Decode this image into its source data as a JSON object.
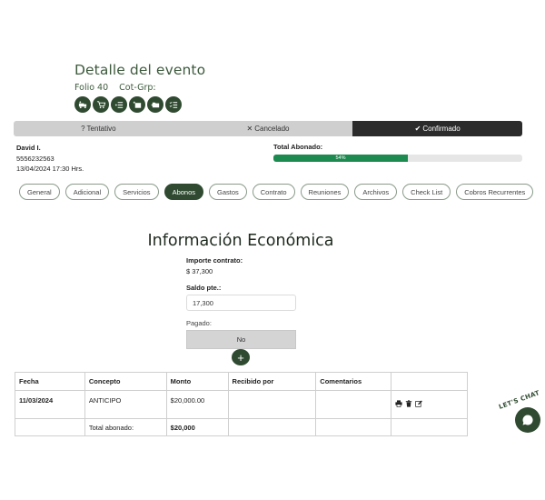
{
  "header": {
    "title": "Detalle del evento",
    "folio": "Folio 40",
    "cot_grp": "Cot-Grp:",
    "action_icons": [
      "truck-add-icon",
      "cart-add-icon",
      "list-add-icon",
      "package-add-icon",
      "folder-add-icon",
      "list-check-icon"
    ]
  },
  "status": {
    "tentativo": "Tentativo",
    "cancelado": "Cancelado",
    "confirmado": "Confirmado",
    "active": "confirmado",
    "active_color": "#2b2b2b"
  },
  "client": {
    "name": "David I.",
    "phone": "5556232563",
    "datetime": "13/04/2024 17:30 Hrs."
  },
  "abono": {
    "label": "Total Abonado:",
    "percent_text": "54%",
    "percent": 54,
    "color": "#1d8a4f"
  },
  "tabs": [
    "General",
    "Adicional",
    "Servicios",
    "Abonos",
    "Gastos",
    "Contrato",
    "Reuniones",
    "Archivos",
    "Check List",
    "Cobros Recurrentes"
  ],
  "active_tab": "Abonos",
  "economica": {
    "title": "Información Económica",
    "importe_label": "Importe contrato:",
    "importe_value": "$ 37,300",
    "saldo_label": "Saldo pte.:",
    "saldo_value": "17,300",
    "pagado_label": "Pagado:",
    "pagado_value": "No",
    "add_label": "+"
  },
  "table": {
    "headers": [
      "Fecha",
      "Concepto",
      "Monto",
      "Recibido por",
      "Comentarios",
      ""
    ],
    "rows": [
      {
        "fecha": "11/03/2024",
        "concepto": "ANTICIPO",
        "monto": "$20,000.00",
        "recibido": "",
        "comentarios": ""
      }
    ],
    "total_label": "Total abonado:",
    "total_value": "$20,000"
  },
  "chat": {
    "label": "LET'S CHAT"
  },
  "colors": {
    "brand": "#2f4a30",
    "title_text": "#3d5a3d",
    "progress": "#1d8a4f"
  }
}
